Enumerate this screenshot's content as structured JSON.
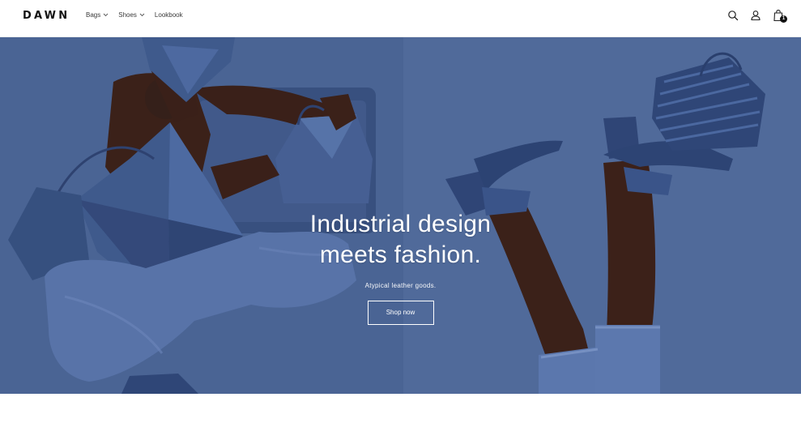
{
  "header": {
    "logo": "DAWN",
    "nav": [
      {
        "label": "Bags",
        "has_dropdown": true
      },
      {
        "label": "Shoes",
        "has_dropdown": true
      },
      {
        "label": "Lookbook",
        "has_dropdown": false
      }
    ],
    "icons": [
      "search-icon",
      "account-icon",
      "cart-icon"
    ],
    "cart_count": "1"
  },
  "hero": {
    "heading_line1": "Industrial design",
    "heading_line2": "meets fashion.",
    "subheading": "Atypical leather goods.",
    "button_label": "Shop now",
    "colors": {
      "background": "#4a6494",
      "bag": "#3b5585",
      "denim": "#5672a8",
      "skin": "#3a2019"
    }
  }
}
